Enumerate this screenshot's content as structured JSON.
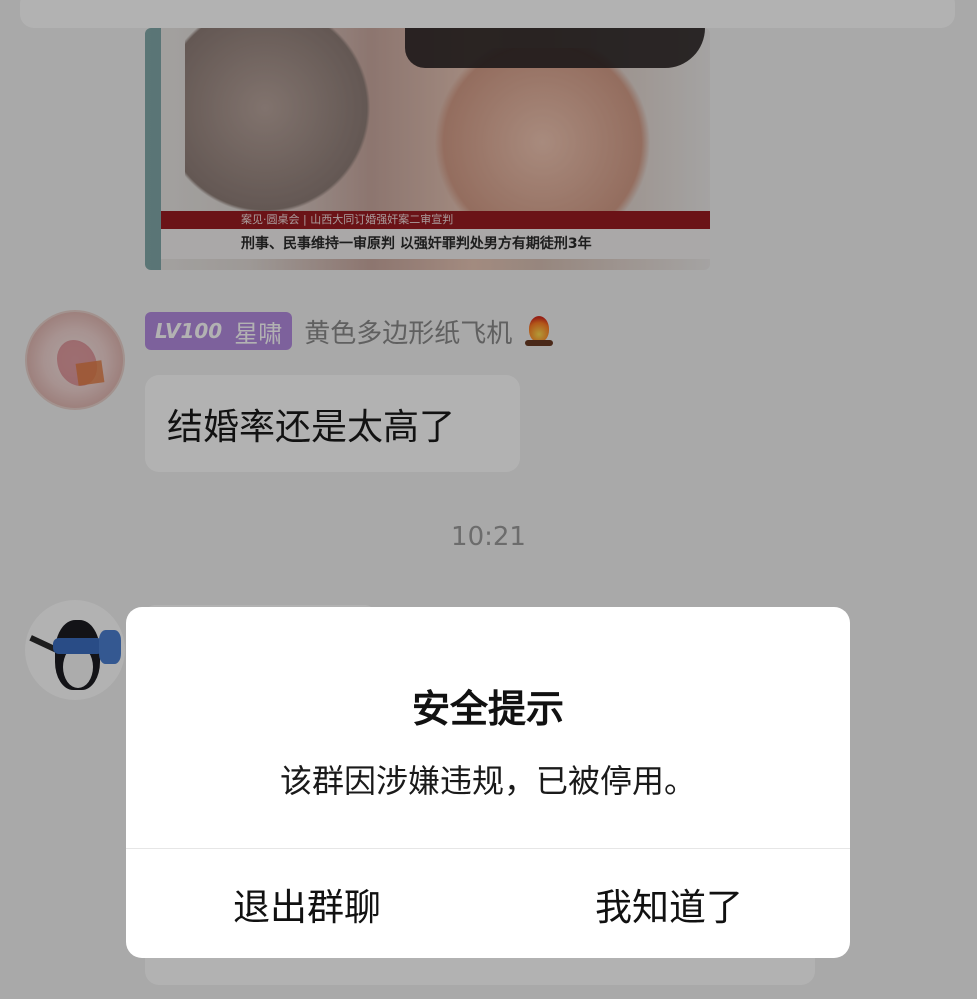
{
  "media": {
    "banner_top": "案见·圆桌会 | 山西大同订婚强奸案二审宣判",
    "banner_bottom": "刑事、民事维持一审原判 以强奸罪判处男方有期徒刑3年"
  },
  "message": {
    "level": "LV100",
    "title": "星啸",
    "sender": "黄色多边形纸飞机",
    "text": "结婚率还是太高了"
  },
  "timestamp": "10:21",
  "dialog": {
    "title": "安全提示",
    "message": "该群因涉嫌违规，已被停用。",
    "left_button": "退出群聊",
    "right_button": "我知道了"
  }
}
